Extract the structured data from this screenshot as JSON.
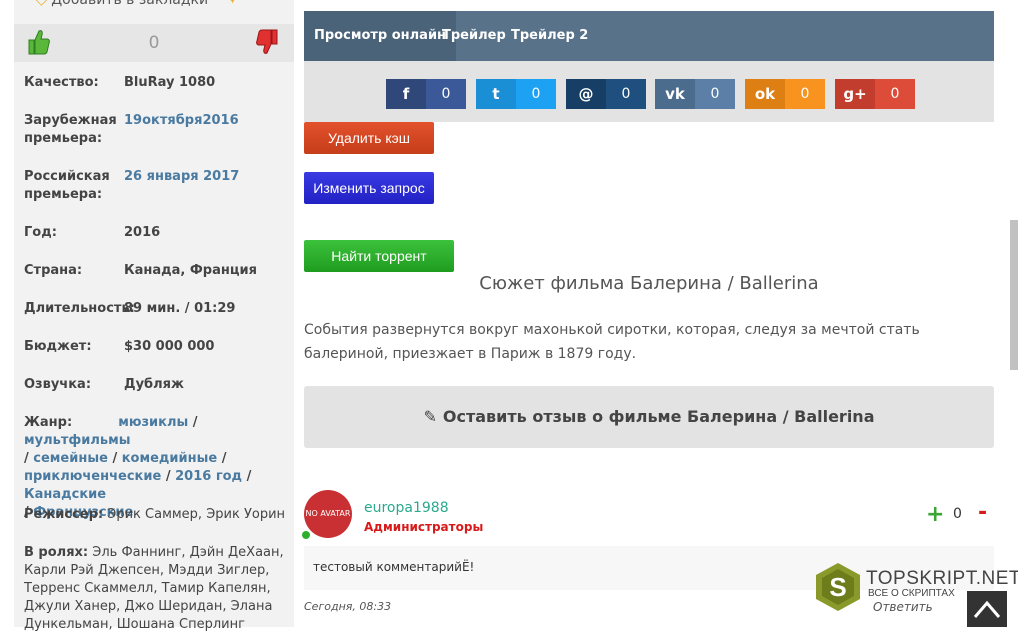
{
  "left": {
    "bookmark_label": "Добавить в закладки",
    "vote_count": "0",
    "info": [
      {
        "label": "Качество:",
        "value": "BluRay 1080"
      },
      {
        "label": "Зарубежная премьера:",
        "value": "19октября2016"
      },
      {
        "label": "Российская премьера:",
        "value": "26 января 2017"
      },
      {
        "label": "Год:",
        "value": "2016"
      },
      {
        "label": "Страна:",
        "value": "Канада, Франция"
      },
      {
        "label": "Длительность:",
        "value": "89 мин. / 01:29"
      },
      {
        "label": "Бюджет:",
        "value": "$30 000 000"
      },
      {
        "label": "Озвучка:",
        "value": "Дубляж"
      }
    ],
    "genre": {
      "label": "Жанр:",
      "items": [
        "мюзиклы",
        "мультфильмы",
        "семейные",
        "комедийные",
        "приключенческие",
        "2016 год",
        "Канадские",
        "Французские"
      ]
    },
    "director": {
      "label": "Режиссер:",
      "value": "Эрик Саммер, Эрик Уорин"
    },
    "cast": {
      "label": "В ролях:",
      "value": "Эль Фаннинг, Дэйн ДеХаан, Карли Рэй Джепсен, Мэдди Зиглер, Терренс Скаммелл, Тамир Капелян, Джули Ханер, Джо Шеридан, Элана Дункельман, Шошана Сперлинг"
    }
  },
  "tabs": [
    "Просмотр онлайн",
    "Трейлер",
    "Трейлер 2"
  ],
  "share": [
    {
      "icon": "facebook-icon",
      "glyph": "f",
      "count": "0",
      "color": "#3b5998",
      "dark": "#2f4779"
    },
    {
      "icon": "twitter-icon",
      "glyph": "t",
      "count": "0",
      "color": "#1da1f2",
      "dark": "#1a8fd6"
    },
    {
      "icon": "mail-icon",
      "glyph": "@",
      "count": "0",
      "color": "#1f4f7e",
      "dark": "#173e64"
    },
    {
      "icon": "vk-icon",
      "glyph": "vk",
      "count": "0",
      "color": "#5b7fa6",
      "dark": "#4c6c8e"
    },
    {
      "icon": "ok-icon",
      "glyph": "ok",
      "count": "0",
      "color": "#f7931e",
      "dark": "#dd7f12"
    },
    {
      "icon": "google-plus-icon",
      "glyph": "g+",
      "count": "0",
      "color": "#dd4b39",
      "dark": "#c23d2d"
    }
  ],
  "buttons": {
    "clear_cache": "Удалить кэш",
    "change_query": "Изменить запрос",
    "find_torrent": "Найти торрент"
  },
  "plot": {
    "title": "Сюжет фильма Балерина / Ballerina",
    "text": "События развернутся вокруг махонькой сиротки, которая, следуя за мечтой стать балериной, приезжает в Париж в 1879 году."
  },
  "review_button": "Оставить отзыв о фильме Балерина / Ballerina",
  "comment": {
    "avatar_text": "NO AVATAR",
    "username": "europa1988",
    "role": "Администраторы",
    "rating": "0",
    "plus": "+",
    "minus": "-",
    "text": "тестовый комментарийЁ!",
    "date": "Сегодня, 08:33",
    "reply": "Ответить"
  },
  "watermark": {
    "brand": "TOPSKRIPT.NET",
    "tagline": "ВСЕ О СКРИПТАХ"
  }
}
